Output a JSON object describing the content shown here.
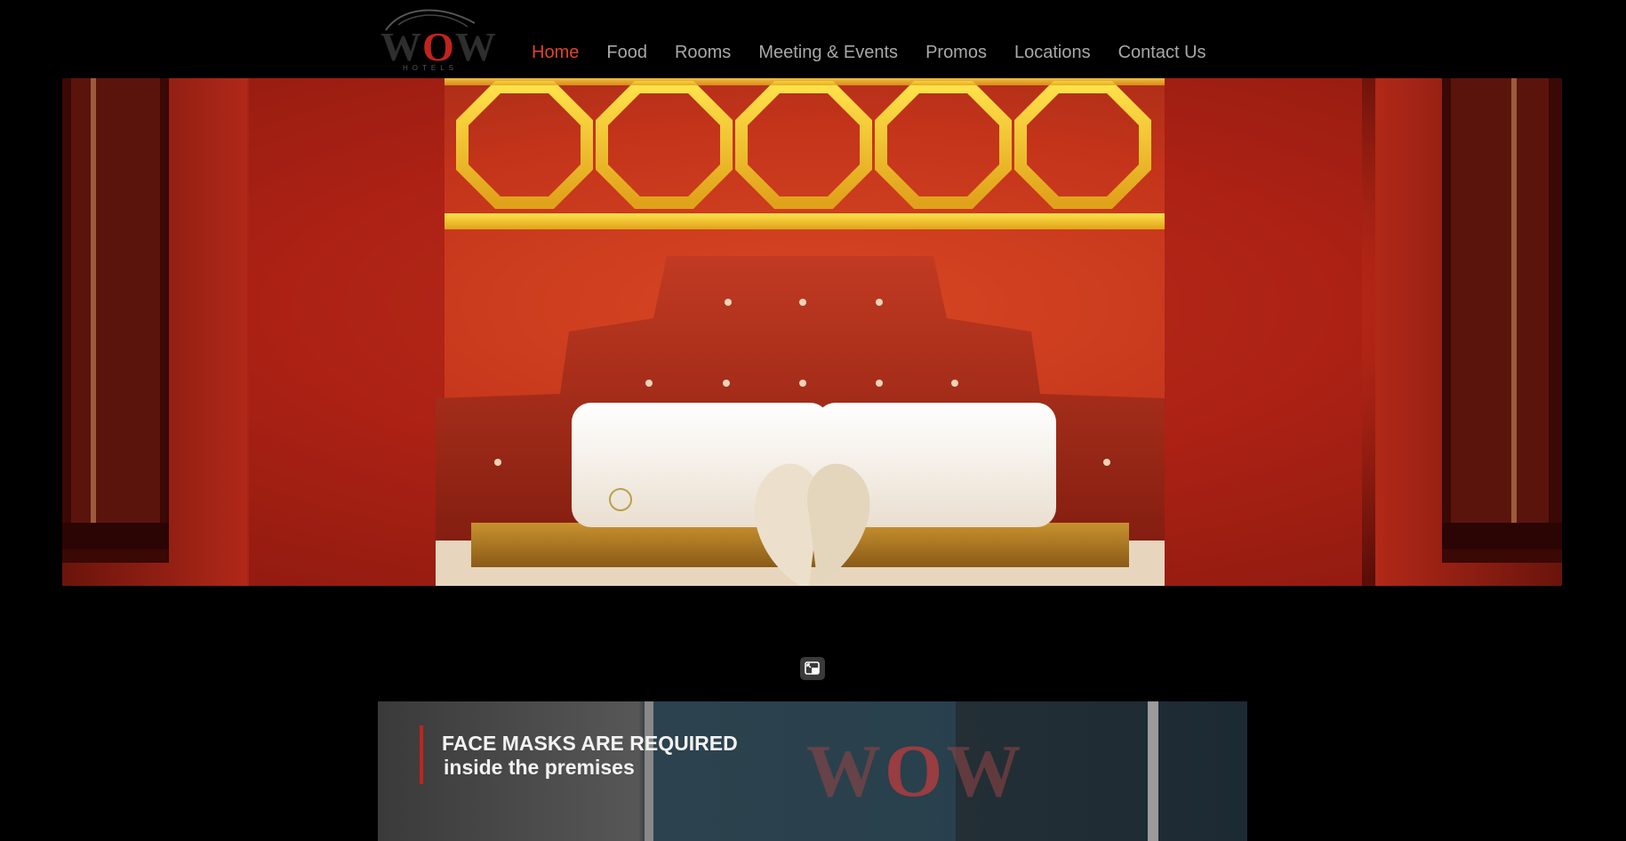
{
  "brand": {
    "name_prefix": "W",
    "name_o": "O",
    "name_suffix": "W",
    "tagline": "HOTELS",
    "accent_color": "#e0432c"
  },
  "nav": {
    "items": [
      {
        "label": "Home",
        "active": true
      },
      {
        "label": "Food",
        "active": false
      },
      {
        "label": "Rooms",
        "active": false
      },
      {
        "label": "Meeting & Events",
        "active": false
      },
      {
        "label": "Promos",
        "active": false
      },
      {
        "label": "Locations",
        "active": false
      },
      {
        "label": "Contact Us",
        "active": false
      }
    ]
  },
  "hero": {
    "icon": "hotel-room-photo"
  },
  "controls": {
    "expand_icon": "expand-window-icon"
  },
  "video": {
    "headline": "FACE MASKS ARE REQUIRED",
    "subline": "inside the premises",
    "watermark_prefix": "W",
    "watermark_o": "O",
    "watermark_suffix": "W"
  }
}
